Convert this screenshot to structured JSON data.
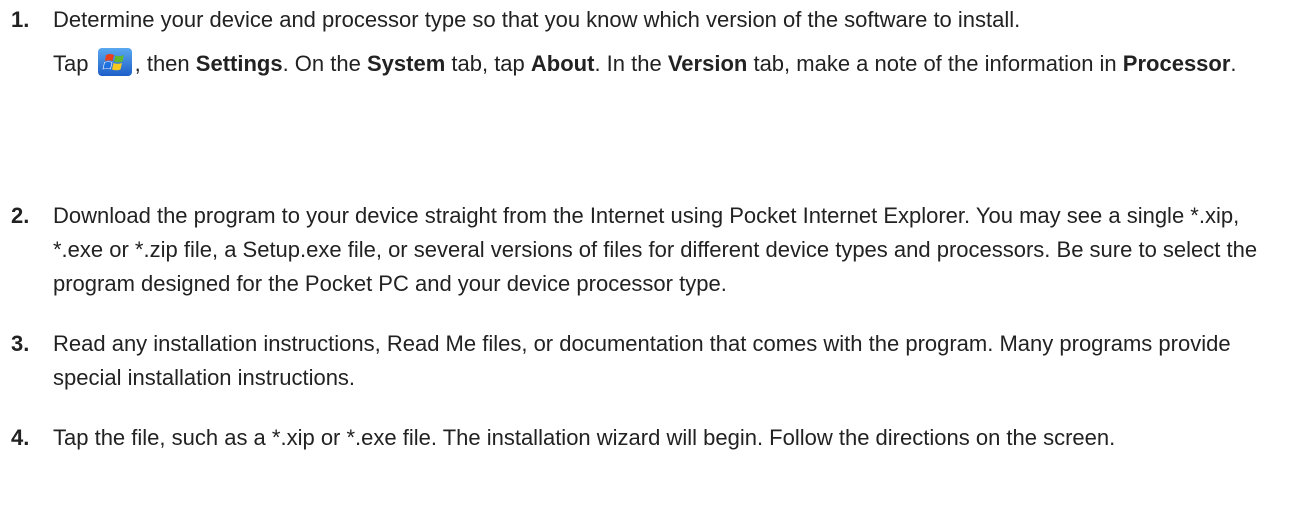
{
  "steps": [
    {
      "number": "1.",
      "text": "Determine your device and processor type so that you know which version of the software to install.",
      "detail": {
        "tap": "Tap",
        "icon": "windows-start-icon",
        "then": ", then",
        "settings": "Settings",
        "on_the": ". On the",
        "system": "System",
        "tab_tap": "tab, tap",
        "about": "About",
        "in_the": ". In the",
        "version": "Version",
        "tab_note": "tab, make a note of the information in",
        "processor": "Processor",
        "end": "."
      }
    },
    {
      "number": "2.",
      "text": "Download the program to your device straight from the Internet using Pocket Internet Explorer. You may see a single *.xip, *.exe or *.zip file, a Setup.exe file, or several versions of files for different device types and processors. Be sure to select the program designed for the Pocket PC and your device processor type."
    },
    {
      "number": "3.",
      "text": "Read any installation instructions, Read Me files, or documentation that comes with the program. Many programs provide special installation instructions."
    },
    {
      "number": "4.",
      "text": "Tap the file, such as a *.xip or *.exe file. The installation wizard will begin. Follow the directions on the screen."
    }
  ],
  "colors": {
    "text": "#222222",
    "background": "#ffffff",
    "icon_red": "#e8401c",
    "icon_green": "#5fb832",
    "icon_blue": "#1e6fe0",
    "icon_yellow": "#f7c81e"
  }
}
